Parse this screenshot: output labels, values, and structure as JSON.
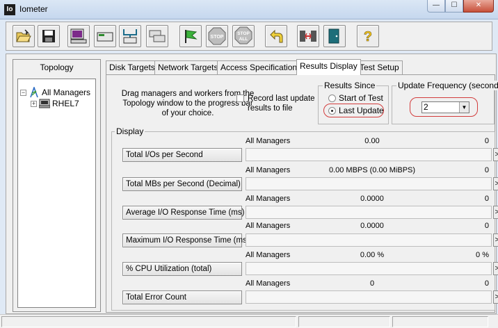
{
  "window": {
    "title": "Iometer",
    "icon_label": "Io",
    "buttons": {
      "minimize": "—",
      "maximize": "☐",
      "close": "✕"
    }
  },
  "toolbar": {
    "buttons": [
      {
        "name": "open-config",
        "icon": "folder-open-icon"
      },
      {
        "name": "save-config",
        "icon": "save-disk-icon"
      },
      {
        "name": "start-display-manager",
        "icon": "monitor-icon"
      },
      {
        "name": "start-disk-worker",
        "icon": "disk-worker-icon"
      },
      {
        "name": "start-network-worker",
        "icon": "network-worker-icon"
      },
      {
        "name": "duplicate-worker",
        "icon": "copy-worker-icon"
      },
      {
        "name": "start-tests",
        "icon": "green-flag-icon"
      },
      {
        "name": "stop",
        "icon": "stop-sign-icon",
        "label": "STOP"
      },
      {
        "name": "stop-all",
        "icon": "stop-all-icon",
        "label": "STOP",
        "sublabel": "ALL"
      },
      {
        "name": "reset-workers",
        "icon": "yellow-return-arrow-icon"
      },
      {
        "name": "disconnect-managers",
        "icon": "disconnect-icon"
      },
      {
        "name": "exit",
        "icon": "exit-door-icon"
      },
      {
        "name": "about",
        "icon": "question-mark-icon",
        "label": "?"
      }
    ]
  },
  "topology": {
    "title": "Topology",
    "tree": [
      {
        "label": "All Managers",
        "expander": "−",
        "level": 0
      },
      {
        "label": "RHEL7",
        "expander": "+",
        "level": 1
      }
    ]
  },
  "tabs": [
    {
      "label": "Disk Targets",
      "active": false
    },
    {
      "label": "Network Targets",
      "active": false
    },
    {
      "label": "Access Specifications",
      "active": false
    },
    {
      "label": "Results Display",
      "active": true
    },
    {
      "label": "Test Setup",
      "active": false
    }
  ],
  "results": {
    "drag_hint": "Drag managers and workers from the Topology window to the progress bar of your choice.",
    "record_checkbox": {
      "label": "Record last update results to file",
      "checked": false
    },
    "results_since": {
      "title": "Results Since",
      "options": [
        {
          "label": "Start of Test",
          "selected": false
        },
        {
          "label": "Last Update",
          "selected": true
        }
      ]
    },
    "update_frequency": {
      "title": "Update Frequency (seconds)",
      "value": "2"
    },
    "display": {
      "title": "Display",
      "rows": [
        {
          "button": "Total I/Os per Second",
          "manager": "All Managers",
          "value": "0.00",
          "right": "0"
        },
        {
          "button": "Total MBs per Second (Decimal)",
          "manager": "All Managers",
          "value": "0.00 MBPS (0.00 MiBPS)",
          "right": "0"
        },
        {
          "button": "Average I/O Response Time (ms)",
          "manager": "All Managers",
          "value": "0.0000",
          "right": "0"
        },
        {
          "button": "Maximum I/O Response Time (ms)",
          "manager": "All Managers",
          "value": "0.0000",
          "right": "0"
        },
        {
          "button": "% CPU Utilization (total)",
          "manager": "All Managers",
          "value": "0.00 %",
          "right": "0 %"
        },
        {
          "button": "Total Error Count",
          "manager": "All Managers",
          "value": "0",
          "right": "0"
        }
      ],
      "arrow_label": ">"
    }
  },
  "colors": {
    "highlight_oval": "#d23c3c",
    "window_frame": "#dfe9f5",
    "panel": "#f0f0f0"
  }
}
